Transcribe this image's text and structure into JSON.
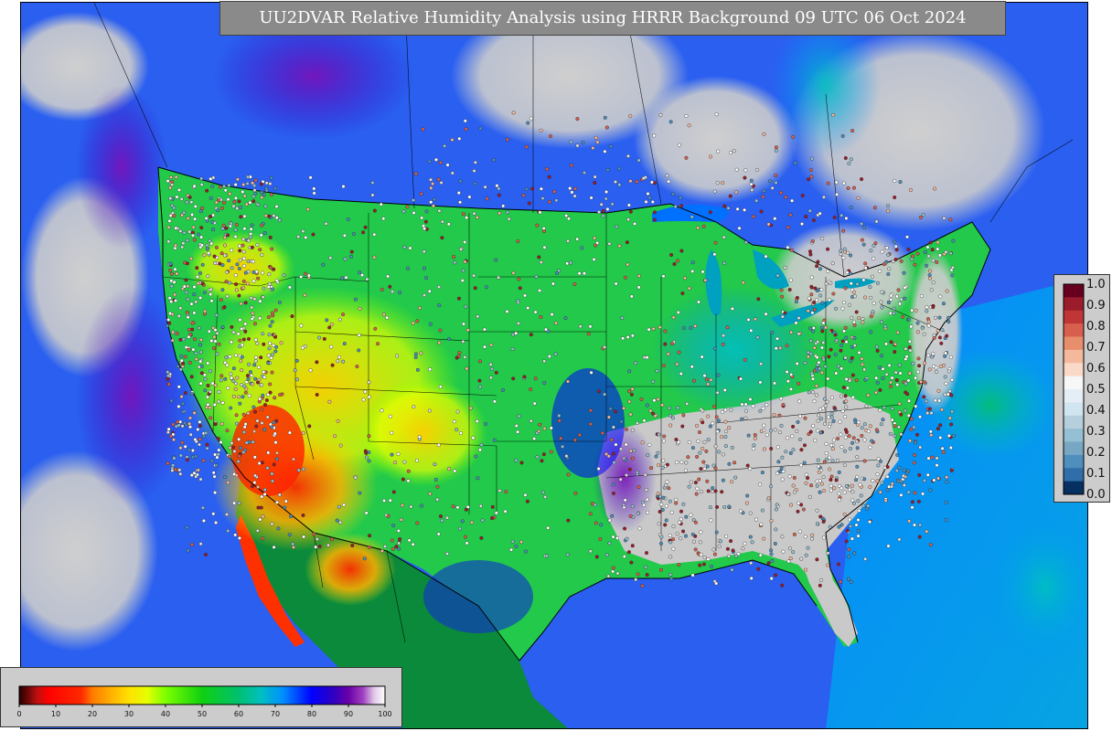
{
  "map": {
    "title": "UU2DVAR Relative Humidity Analysis using HRRR Background 09 UTC 06 Oct 2024",
    "field": "relative-humidity-percent",
    "projection": "lambert-conformal",
    "ocean_color": "#2a6cf0",
    "land_color": "#22c94a",
    "missing_color": "#cccccc",
    "boundary_color": "#000000"
  },
  "rh_colorbar": {
    "ticks": [
      "0",
      "10",
      "20",
      "30",
      "40",
      "50",
      "60",
      "70",
      "80",
      "90",
      "100"
    ],
    "stops": [
      {
        "v": 0,
        "c": "#220000"
      },
      {
        "v": 5,
        "c": "#c01010"
      },
      {
        "v": 8,
        "c": "#ff0000"
      },
      {
        "v": 17,
        "c": "#ff2a00"
      },
      {
        "v": 20,
        "c": "#ff7a00"
      },
      {
        "v": 25,
        "c": "#ffb000"
      },
      {
        "v": 30,
        "c": "#ffe000"
      },
      {
        "v": 35,
        "c": "#e6ff00"
      },
      {
        "v": 40,
        "c": "#7dff00"
      },
      {
        "v": 50,
        "c": "#10d010"
      },
      {
        "v": 60,
        "c": "#00c070"
      },
      {
        "v": 66,
        "c": "#00c0c0"
      },
      {
        "v": 72,
        "c": "#0090ff"
      },
      {
        "v": 80,
        "c": "#0000ff"
      },
      {
        "v": 86,
        "c": "#3000c0"
      },
      {
        "v": 90,
        "c": "#6a00a8"
      },
      {
        "v": 94,
        "c": "#a040c0"
      },
      {
        "v": 97,
        "c": "#e0c8e8"
      },
      {
        "v": 100,
        "c": "#ffffff"
      }
    ]
  },
  "innov_legend": {
    "ticks": [
      "1.0",
      "0.9",
      "0.8",
      "0.7",
      "0.6",
      "0.5",
      "0.4",
      "0.3",
      "0.2",
      "0.1",
      "0.0"
    ],
    "colors": [
      "#67001f",
      "#9b1c2a",
      "#c03636",
      "#d6604d",
      "#e78e6c",
      "#f4b89c",
      "#fbd9c8",
      "#f7f7f7",
      "#e5eef4",
      "#d1e5f0",
      "#b6cfdc",
      "#95bfd2",
      "#78a7c4",
      "#4f8fbd",
      "#2f6ea8",
      "#053061"
    ]
  }
}
